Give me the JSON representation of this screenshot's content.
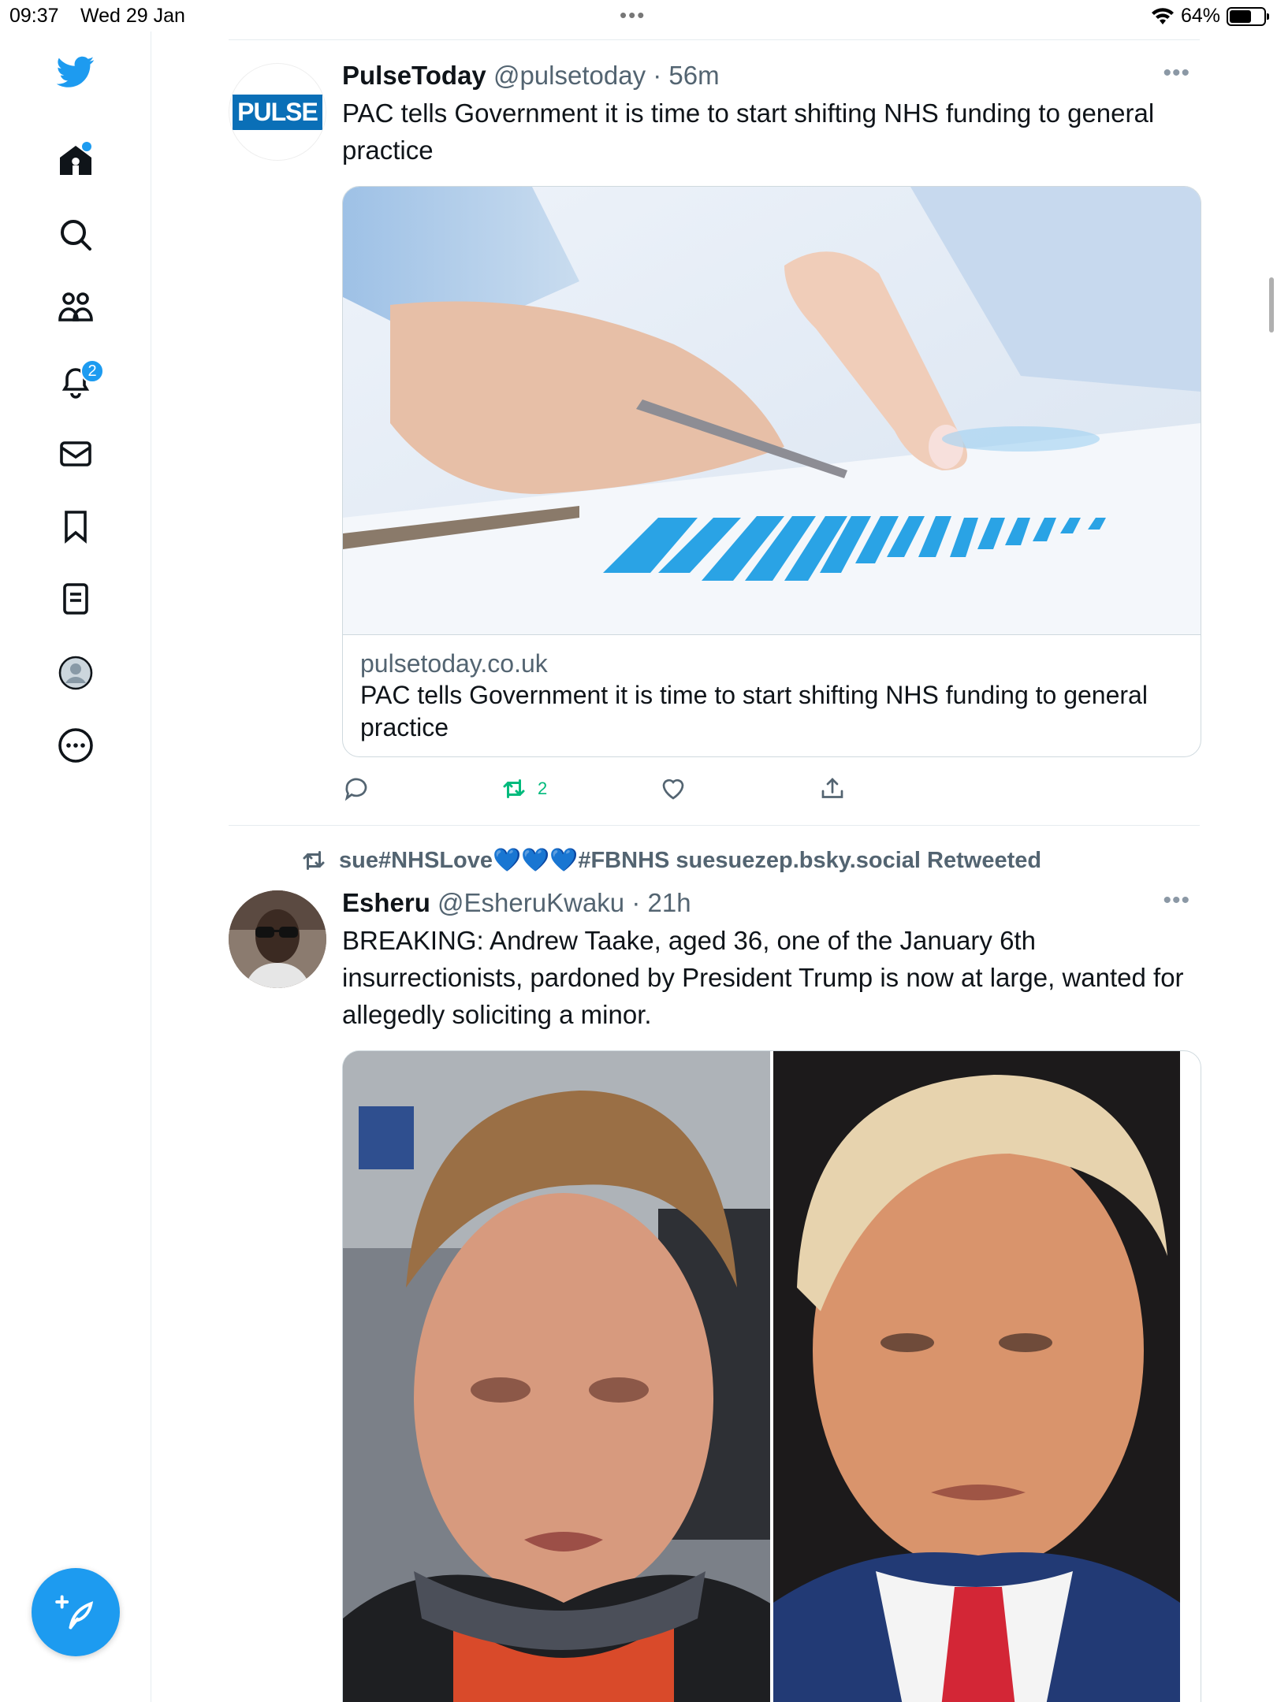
{
  "status_bar": {
    "time": "09:37",
    "date": "Wed 29 Jan",
    "dots": "•••",
    "battery": "64%",
    "battery_level": 0.64
  },
  "sidebar": {
    "notifications_badge": "2",
    "items": [
      {
        "name": "twitter-logo-icon"
      },
      {
        "name": "home-icon"
      },
      {
        "name": "search-icon"
      },
      {
        "name": "communities-icon"
      },
      {
        "name": "notifications-icon"
      },
      {
        "name": "messages-icon"
      },
      {
        "name": "bookmarks-icon"
      },
      {
        "name": "lists-icon"
      },
      {
        "name": "profile-icon"
      },
      {
        "name": "more-icon"
      }
    ],
    "accent_color": "#1d9bf0"
  },
  "tweets": [
    {
      "name": "PulseToday",
      "handle": "@pulsetoday",
      "separator": " · ",
      "time": "56m",
      "more": "•••",
      "avatar_text": "PULSE",
      "text": "PAC tells Government it is time to start shifting NHS funding to general practice",
      "card": {
        "domain": "pulsetoday.co.uk",
        "title": "PAC tells Government it is time to start shifting NHS funding to general practice"
      },
      "actions": {
        "retweets": "2"
      }
    },
    {
      "retweet_context": "sue#NHSLove💙💙💙#FBNHS suesuezep.bsky.social Retweeted",
      "name": "Esheru",
      "handle": "@EsheruKwaku",
      "separator": " · ",
      "time": "21h",
      "more": "•••",
      "text": "BREAKING: Andrew Taake, aged 36, one of the January 6th insurrectionists, pardoned by President Trump is now at large, wanted for allegedly soliciting a minor."
    }
  ]
}
